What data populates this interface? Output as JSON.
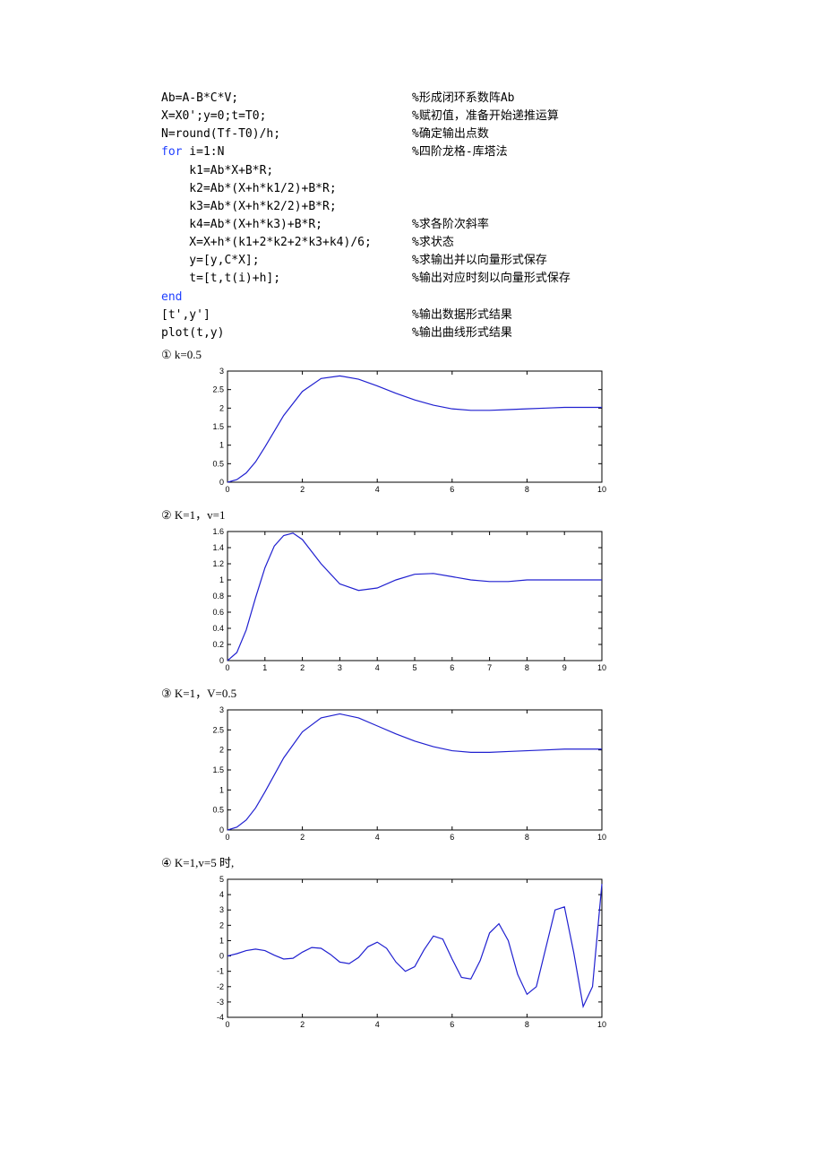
{
  "code": [
    {
      "l": "Ab=A-B*C*V;",
      "r": "%形成闭环系数阵Ab",
      "indent": 0
    },
    {
      "l": "X=X0';y=0;t=T0;",
      "r": "%赋初值，准备开始递推运算",
      "indent": 0
    },
    {
      "l": "N=round(Tf-T0)/h;",
      "r": "%确定输出点数",
      "indent": 0
    },
    {
      "l": "for i=1:N",
      "r": "%四阶龙格-库塔法",
      "indent": 0,
      "kw": "for"
    },
    {
      "l": "k1=Ab*X+B*R;",
      "r": "",
      "indent": 1
    },
    {
      "l": "k2=Ab*(X+h*k1/2)+B*R;",
      "r": "",
      "indent": 1
    },
    {
      "l": "k3=Ab*(X+h*k2/2)+B*R;",
      "r": "",
      "indent": 1
    },
    {
      "l": "k4=Ab*(X+h*k3)+B*R;",
      "r": "%求各阶次斜率",
      "indent": 1
    },
    {
      "l": "X=X+h*(k1+2*k2+2*k3+k4)/6;",
      "r": "%求状态",
      "indent": 1
    },
    {
      "l": "y=[y,C*X];",
      "r": "%求输出并以向量形式保存",
      "indent": 1
    },
    {
      "l": "t=[t,t(i)+h];",
      "r": "%输出对应时刻以向量形式保存",
      "indent": 1
    },
    {
      "l": "end",
      "r": "",
      "indent": 0,
      "kw": "end"
    },
    {
      "l": "[t',y']",
      "r": "%输出数据形式结果",
      "indent": 0
    },
    {
      "l": "plot(t,y)",
      "r": "%输出曲线形式结果",
      "indent": 0
    }
  ],
  "captions": {
    "c1": "① k=0.5",
    "c2": "② K=1，v=1",
    "c3": "③ K=1，V=0.5",
    "c4": "④ K=1,v=5 时,"
  },
  "chart_data": [
    {
      "type": "line",
      "title": "",
      "xlabel": "",
      "ylabel": "",
      "xlim": [
        0,
        10
      ],
      "ylim": [
        0,
        3
      ],
      "xticks": [
        0,
        2,
        4,
        6,
        8,
        10
      ],
      "yticks": [
        0,
        0.5,
        1,
        1.5,
        2,
        2.5,
        3
      ],
      "x": [
        0,
        0.25,
        0.5,
        0.75,
        1,
        1.5,
        2,
        2.5,
        3,
        3.5,
        4,
        4.5,
        5,
        5.5,
        6,
        6.5,
        7,
        7.5,
        8,
        8.5,
        9,
        9.5,
        10
      ],
      "y": [
        0,
        0.07,
        0.25,
        0.55,
        0.95,
        1.8,
        2.45,
        2.8,
        2.87,
        2.78,
        2.6,
        2.4,
        2.22,
        2.08,
        1.98,
        1.94,
        1.94,
        1.96,
        1.98,
        2.0,
        2.02,
        2.02,
        2.02
      ]
    },
    {
      "type": "line",
      "title": "",
      "xlabel": "",
      "ylabel": "",
      "xlim": [
        0,
        10
      ],
      "ylim": [
        0,
        1.6
      ],
      "xticks": [
        0,
        1,
        2,
        3,
        4,
        5,
        6,
        7,
        8,
        9,
        10
      ],
      "yticks": [
        0,
        0.2,
        0.4,
        0.6,
        0.8,
        1,
        1.2,
        1.4,
        1.6
      ],
      "x": [
        0,
        0.25,
        0.5,
        0.75,
        1,
        1.25,
        1.5,
        1.75,
        2,
        2.5,
        3,
        3.5,
        4,
        4.5,
        5,
        5.5,
        6,
        6.5,
        7,
        7.5,
        8,
        8.5,
        9,
        9.5,
        10
      ],
      "y": [
        0,
        0.1,
        0.38,
        0.78,
        1.15,
        1.42,
        1.55,
        1.58,
        1.5,
        1.2,
        0.95,
        0.87,
        0.9,
        1.0,
        1.07,
        1.08,
        1.04,
        1.0,
        0.98,
        0.98,
        1.0,
        1.0,
        1.0,
        1.0,
        1.0
      ]
    },
    {
      "type": "line",
      "title": "",
      "xlabel": "",
      "ylabel": "",
      "xlim": [
        0,
        10
      ],
      "ylim": [
        0,
        3
      ],
      "xticks": [
        0,
        2,
        4,
        6,
        8,
        10
      ],
      "yticks": [
        0,
        0.5,
        1,
        1.5,
        2,
        2.5,
        3
      ],
      "x": [
        0,
        0.25,
        0.5,
        0.75,
        1,
        1.5,
        2,
        2.5,
        3,
        3.5,
        4,
        4.5,
        5,
        5.5,
        6,
        6.5,
        7,
        7.5,
        8,
        8.5,
        9,
        9.5,
        10
      ],
      "y": [
        0,
        0.07,
        0.25,
        0.55,
        0.95,
        1.8,
        2.45,
        2.8,
        2.9,
        2.8,
        2.6,
        2.4,
        2.22,
        2.08,
        1.98,
        1.94,
        1.94,
        1.96,
        1.98,
        2.0,
        2.02,
        2.02,
        2.02
      ]
    },
    {
      "type": "line",
      "title": "",
      "xlabel": "",
      "ylabel": "",
      "xlim": [
        0,
        10
      ],
      "ylim": [
        -4,
        5
      ],
      "xticks": [
        0,
        2,
        4,
        6,
        8,
        10
      ],
      "yticks": [
        -4,
        -3,
        -2,
        -1,
        0,
        1,
        2,
        3,
        4,
        5
      ],
      "x": [
        0,
        0.25,
        0.5,
        0.75,
        1,
        1.25,
        1.5,
        1.75,
        2,
        2.25,
        2.5,
        2.75,
        3,
        3.25,
        3.5,
        3.75,
        4,
        4.25,
        4.5,
        4.75,
        5,
        5.25,
        5.5,
        5.75,
        6,
        6.25,
        6.5,
        6.75,
        7,
        7.25,
        7.5,
        7.75,
        8,
        8.25,
        8.5,
        8.75,
        9,
        9.25,
        9.5,
        9.75,
        10
      ],
      "y": [
        0,
        0.15,
        0.35,
        0.45,
        0.35,
        0.05,
        -0.2,
        -0.15,
        0.25,
        0.55,
        0.5,
        0.1,
        -0.4,
        -0.5,
        -0.1,
        0.6,
        0.9,
        0.5,
        -0.4,
        -1.0,
        -0.7,
        0.4,
        1.3,
        1.1,
        -0.2,
        -1.4,
        -1.5,
        -0.3,
        1.5,
        2.1,
        1.0,
        -1.2,
        -2.5,
        -2.0,
        0.5,
        3.0,
        3.2,
        0.2,
        -3.3,
        -2.0,
        4.7
      ]
    }
  ]
}
